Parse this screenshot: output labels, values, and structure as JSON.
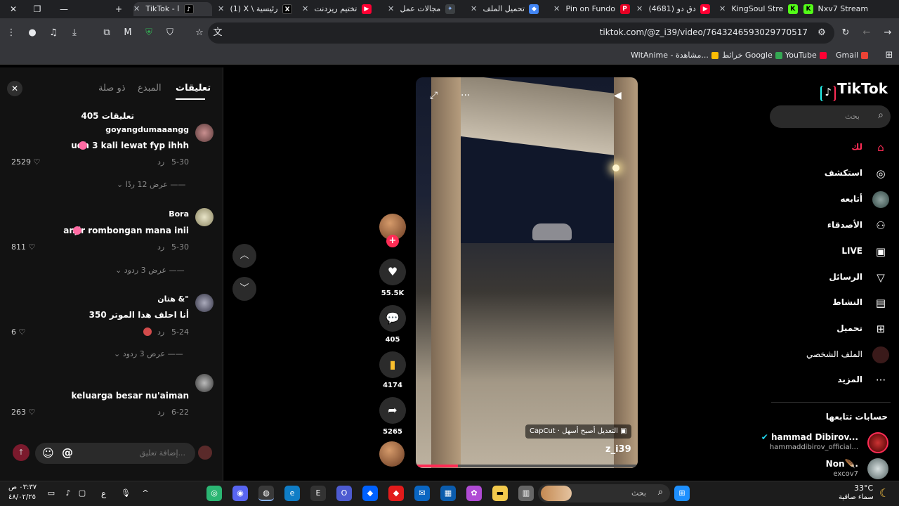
{
  "browser": {
    "tabs": [
      {
        "title": "Nxv7 Stream",
        "favicon": "K",
        "color": "#53fc18"
      },
      {
        "title": "KingSoul Stre",
        "favicon": "K",
        "color": "#53fc18"
      },
      {
        "title": "(4681) دق دو",
        "favicon": "▶",
        "color": "#ff0033"
      },
      {
        "title": "Pin on Fundo",
        "favicon": "P",
        "color": "#e60023"
      },
      {
        "title": "تحميل الملف",
        "favicon": "◆",
        "color": "#4285f4"
      },
      {
        "title": "مجالات عمل",
        "favicon": "✦",
        "color": "#8ab4f8"
      },
      {
        "title": "تختيم ريزدنت",
        "favicon": "▶",
        "color": "#ff0033"
      },
      {
        "title": "(1) X \\ رئيسية",
        "favicon": "X",
        "color": "#000000"
      },
      {
        "title": "TikTok - ا",
        "favicon": "♪",
        "color": "#000000"
      }
    ],
    "url": "tiktok.com/@z_i39/video/7643246593029770517",
    "bookmarks": [
      {
        "label": "Gmail",
        "color": "#ea4335"
      },
      {
        "label": "YouTube",
        "color": "#ff0033"
      },
      {
        "label": "خرائط Google",
        "color": "#34a853"
      },
      {
        "label": "WitAnime - مشاهدة...",
        "color": "#fbbc04"
      }
    ]
  },
  "sidebar": {
    "logo": "TikTok",
    "search_placeholder": "بحث",
    "items": [
      {
        "label": "لك",
        "icon": "home-icon",
        "glyph": "⌂",
        "active": true
      },
      {
        "label": "استكشف",
        "icon": "compass-icon",
        "glyph": "◎"
      },
      {
        "label": "أتابعه",
        "icon": "following-avatar-icon",
        "glyph": "●"
      },
      {
        "label": "الأصدقاء",
        "icon": "friends-icon",
        "glyph": "👥"
      },
      {
        "label": "LIVE",
        "icon": "live-icon",
        "glyph": "📺"
      },
      {
        "label": "الرسائل",
        "icon": "messages-icon",
        "glyph": "➢"
      },
      {
        "label": "النشاط",
        "icon": "activity-icon",
        "glyph": "▤"
      },
      {
        "label": "تحميل",
        "icon": "upload-icon",
        "glyph": "⊞"
      },
      {
        "label": "الملف الشخصي",
        "icon": "profile-icon",
        "glyph": "●"
      },
      {
        "label": "المزيد",
        "icon": "more-icon",
        "glyph": "···"
      }
    ],
    "following_title": "حسابات تتابعها",
    "accounts": [
      {
        "name": "hammad Dibirov...",
        "handle": "hammaddibirov_official...",
        "verified": true
      },
      {
        "name": "Non🪶.",
        "handle": "excov7"
      }
    ]
  },
  "video": {
    "author": "z_i39",
    "capcut_badge": "CapCut · التعديل أصبح أسهل",
    "progress": 0.19,
    "actions": {
      "likes": "55.5K",
      "comments": "405",
      "saves": "4174",
      "shares": "5265"
    }
  },
  "comments": {
    "tabs": [
      "تعليقات",
      "المبدع",
      "ذو صلة"
    ],
    "count": "405 تعليقات",
    "input_placeholder": "إضافة تعليق...",
    "reply_label": "رد",
    "items": [
      {
        "user": "goyangdumaaangg",
        "text": "udh 3 kali lewat fyp ihhh",
        "date": "5-30",
        "likes": "2529",
        "more": "عرض 12 ردًا"
      },
      {
        "user": "Bora",
        "text": "anjir rombongan mana inii",
        "date": "5-30",
        "likes": "811",
        "more": "عرض 3 ردود"
      },
      {
        "user": "هتان &\"",
        "text": "أنا احلف هذا الموتر 350",
        "date": "5-24",
        "likes": "6",
        "more": "عرض 3 ردود"
      },
      {
        "user": "",
        "text": "keluarga besar nu'aiman",
        "date": "6-22",
        "likes": "263"
      }
    ]
  },
  "taskbar": {
    "search_placeholder": "بحث",
    "weather_temp": "33°C",
    "weather_desc": "سماء صافية",
    "time": "٠٣:٣٧ ص",
    "date": "٤٨/٠٢/٢٥",
    "lang": "ع"
  }
}
